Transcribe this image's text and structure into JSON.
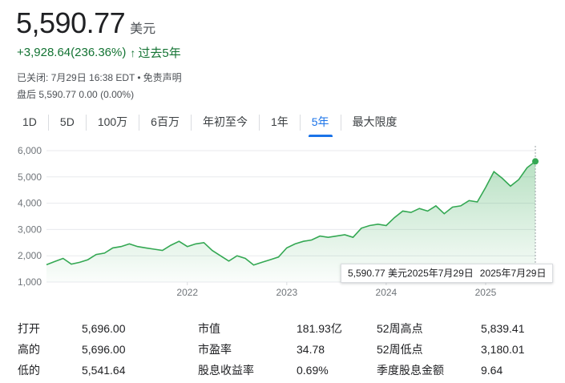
{
  "quote": {
    "price": "5,590.77",
    "currency": "美元",
    "change": "+3,928.64(236.36%)",
    "change_arrow": "↑",
    "period": "过去5年",
    "closed_label": "已关闭: 7月29日 16:38 EDT",
    "disclaimer": "免责声明",
    "after_hours": "盘后 5,590.77  0.00 (0.00%)",
    "accent_color": "#137333"
  },
  "ranges": [
    {
      "label": "1D",
      "active": false
    },
    {
      "label": "5D",
      "active": false
    },
    {
      "label": "100万",
      "active": false
    },
    {
      "label": "6百万",
      "active": false
    },
    {
      "label": "年初至今",
      "active": false
    },
    {
      "label": "1年",
      "active": false
    },
    {
      "label": "5年",
      "active": true
    },
    {
      "label": "最大限度",
      "active": false
    }
  ],
  "tooltip": {
    "value": "5,590.77 美元2025年7月29日",
    "date": "2025年7月29日"
  },
  "chart_data": {
    "type": "area",
    "y_ticks": [
      "1,000",
      "2,000",
      "3,000",
      "4,000",
      "5,000",
      "6,000"
    ],
    "x_ticks": [
      "2022",
      "2023",
      "2024",
      "2025"
    ],
    "ylim": [
      1000,
      6000
    ],
    "line_color": "#34a853",
    "x": [
      "2020-08",
      "2020-09",
      "2020-10",
      "2020-11",
      "2020-12",
      "2021-01",
      "2021-02",
      "2021-03",
      "2021-04",
      "2021-05",
      "2021-06",
      "2021-07",
      "2021-08",
      "2021-09",
      "2021-10",
      "2021-11",
      "2021-12",
      "2022-01",
      "2022-02",
      "2022-03",
      "2022-04",
      "2022-05",
      "2022-06",
      "2022-07",
      "2022-08",
      "2022-09",
      "2022-10",
      "2022-11",
      "2022-12",
      "2023-01",
      "2023-02",
      "2023-03",
      "2023-04",
      "2023-05",
      "2023-06",
      "2023-07",
      "2023-08",
      "2023-09",
      "2023-10",
      "2023-11",
      "2023-12",
      "2024-01",
      "2024-02",
      "2024-03",
      "2024-04",
      "2024-05",
      "2024-06",
      "2024-07",
      "2024-08",
      "2024-09",
      "2024-10",
      "2024-11",
      "2024-12",
      "2025-01",
      "2025-02",
      "2025-03",
      "2025-04",
      "2025-05",
      "2025-06",
      "2025-07"
    ],
    "values": [
      1660,
      1780,
      1900,
      1680,
      1750,
      1850,
      2050,
      2100,
      2300,
      2350,
      2450,
      2350,
      2300,
      2250,
      2200,
      2400,
      2550,
      2350,
      2450,
      2500,
      2200,
      2000,
      1800,
      2000,
      1900,
      1650,
      1750,
      1850,
      1950,
      2300,
      2450,
      2550,
      2600,
      2750,
      2700,
      2750,
      2800,
      2700,
      3050,
      3150,
      3200,
      3150,
      3450,
      3700,
      3650,
      3800,
      3700,
      3900,
      3600,
      3850,
      3900,
      4100,
      4050,
      4600,
      5200,
      4950,
      4650,
      4900,
      5350,
      5590.77
    ]
  },
  "stats": [
    [
      {
        "label": "打开",
        "value": "5,696.00"
      },
      {
        "label": "市值",
        "value": "181.93亿"
      },
      {
        "label": "52周高点",
        "value": "5,839.41"
      }
    ],
    [
      {
        "label": "高的",
        "value": "5,696.00"
      },
      {
        "label": "市盈率",
        "value": "34.78"
      },
      {
        "label": "52周低点",
        "value": "3,180.01"
      }
    ],
    [
      {
        "label": "低的",
        "value": "5,541.64"
      },
      {
        "label": "股息收益率",
        "value": "0.69%"
      },
      {
        "label": "季度股息金额",
        "value": "9.64"
      }
    ]
  ]
}
